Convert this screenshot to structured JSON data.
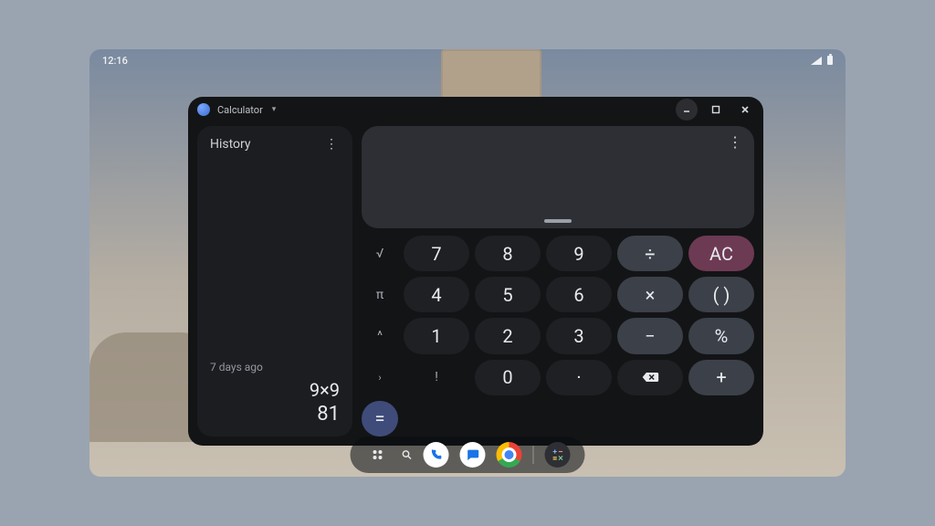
{
  "status": {
    "clock": "12:16"
  },
  "window": {
    "title": "Calculator"
  },
  "history": {
    "title": "History",
    "entries": [
      {
        "label": "7 days ago",
        "expression": "9×9",
        "result": "81"
      }
    ]
  },
  "display": {
    "value": ""
  },
  "sci_keys": {
    "sqrt": "√",
    "pi": "π",
    "pow": "^",
    "fact": "!",
    "more": "›"
  },
  "keys": {
    "n0": "0",
    "n1": "1",
    "n2": "2",
    "n3": "3",
    "n4": "4",
    "n5": "5",
    "n6": "6",
    "n7": "7",
    "n8": "8",
    "n9": "9",
    "dot": "·",
    "div": "÷",
    "mul": "×",
    "sub": "−",
    "add": "+",
    "eq": "=",
    "ac": "AC",
    "paren": "( )",
    "pct": "%"
  },
  "taskbar": {
    "apps": [
      "launcher",
      "search",
      "phone",
      "messages",
      "chrome",
      "calculator"
    ]
  }
}
